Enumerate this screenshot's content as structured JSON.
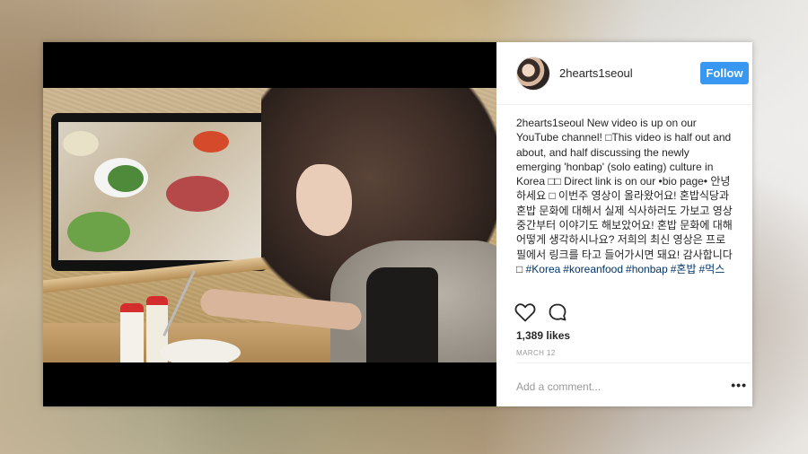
{
  "post": {
    "username": "2hearts1seoul",
    "follow_label": "Follow",
    "caption_user": "2hearts1seoul",
    "caption_text": "New video is up on our YouTube channel! □This video is half out and about, and half discussing the newly emerging 'honbap' (solo eating) culture in Korea □□ Direct link is on our •bio page• 안녕하세요 □ 이번주 영상이 올라왔어요! 혼밥식당과 혼밥 문화에 대해서 실제 식사하러도 가보고 영상 중간부터 이야기도 해보았어요! 혼밥 문화에 대해 어떻게 생각하시나요? 저희의 최신 영상은 프로필에서 링크를 타고 들어가시면 돼요! 감사합니다 □",
    "hashtags": [
      "#Korea",
      "#koreanfood",
      "#honbap",
      "#혼밥",
      "#먹스"
    ],
    "likes": "1,389 likes",
    "date": "MARCH 12",
    "comment_placeholder": "Add a comment...",
    "more_label": "•••"
  },
  "icons": {
    "like": "heart-icon",
    "comment": "comment-icon"
  },
  "colors": {
    "follow_button": "#3897f0",
    "hashtag": "#003569"
  }
}
